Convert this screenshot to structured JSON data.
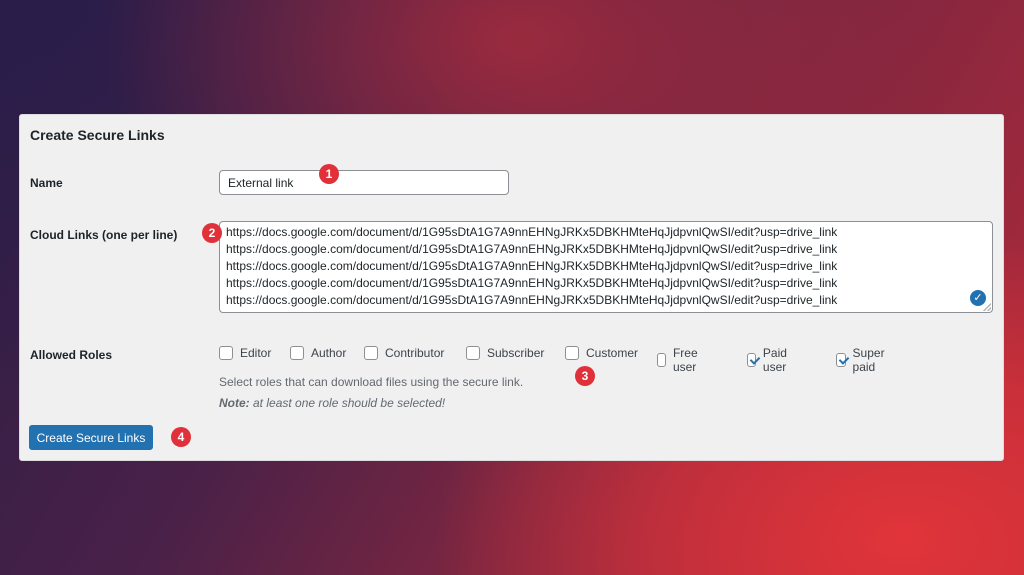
{
  "form": {
    "title": "Create Secure Links",
    "name_label": "Name",
    "name_value": "External link",
    "cloud_links_label": "Cloud Links (one per line)",
    "cloud_links": [
      "https://docs.google.com/document/d/1G95sDtA1G7A9nnEHNgJRKx5DBKHMteHqJjdpvnlQwSI/edit?usp=drive_link",
      "https://docs.google.com/document/d/1G95sDtA1G7A9nnEHNgJRKx5DBKHMteHqJjdpvnlQwSI/edit?usp=drive_link",
      "https://docs.google.com/document/d/1G95sDtA1G7A9nnEHNgJRKx5DBKHMteHqJjdpvnlQwSI/edit?usp=drive_link",
      "https://docs.google.com/document/d/1G95sDtA1G7A9nnEHNgJRKx5DBKHMteHqJjdpvnlQwSI/edit?usp=drive_link",
      "https://docs.google.com/document/d/1G95sDtA1G7A9nnEHNgJRKx5DBKHMteHqJjdpvnlQwSI/edit?usp=drive_link"
    ],
    "allowed_roles_label": "Allowed Roles",
    "roles": [
      {
        "label": "Editor",
        "checked": false
      },
      {
        "label": "Author",
        "checked": false
      },
      {
        "label": "Contributor",
        "checked": false
      },
      {
        "label": "Subscriber",
        "checked": false
      },
      {
        "label": "Customer",
        "checked": false
      },
      {
        "label": "Free user",
        "checked": false
      },
      {
        "label": "Paid user",
        "checked": true
      },
      {
        "label": "Super paid",
        "checked": true
      }
    ],
    "roles_description": "Select roles that can download files using the secure link.",
    "note_prefix": "Note:",
    "note_text": " at least one role should be selected!",
    "submit_label": "Create Secure Links"
  },
  "markers": [
    "1",
    "2",
    "3",
    "4"
  ],
  "colors": {
    "accent": "#2271b1",
    "marker": "#e0303a"
  }
}
